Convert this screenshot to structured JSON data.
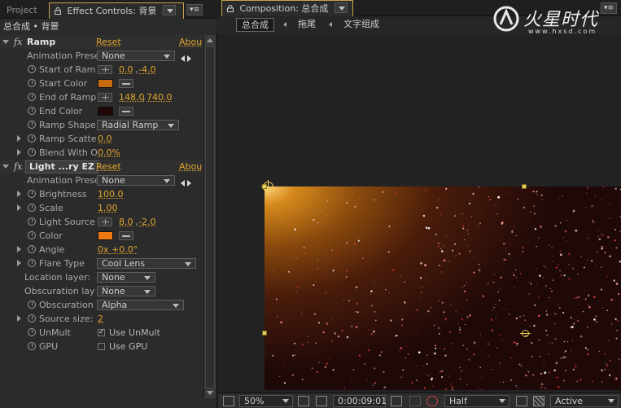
{
  "left_panel": {
    "tabs": {
      "project": "Project",
      "effect_controls": "Effect Controls: 背景"
    },
    "subtitle": "总合成 • 背景",
    "ramp": {
      "name": "Ramp",
      "reset": "Reset",
      "about": "Abou",
      "animation_preset_label": "Animation Prese",
      "animation_preset_value": "None",
      "start_of_ramp_label": "Start of Ram",
      "start_of_ramp_value_x": "0.0",
      "start_of_ramp_value_y": "-4.0",
      "start_color_label": "Start Color",
      "start_color": "#c86a10",
      "end_of_ramp_label": "End of Ramp",
      "end_of_ramp_value_x": "148.0",
      "end_of_ramp_value_y": "740.0",
      "end_color_label": "End Color",
      "end_color": "#200606",
      "ramp_shape_label": "Ramp Shape",
      "ramp_shape_value": "Radial Ramp",
      "ramp_scatter_label": "Ramp Scatte",
      "ramp_scatter_value": "0.0",
      "blend_label": "Blend With O",
      "blend_value": "0.0%"
    },
    "light": {
      "name": "Light ...ry EZ",
      "reset": "Reset",
      "about": "Abou",
      "animation_preset_label": "Animation Prese",
      "animation_preset_value": "None",
      "brightness_label": "Brightness",
      "brightness_value": "100.0",
      "scale_label": "Scale",
      "scale_value": "1.00",
      "light_source_label": "Light Source",
      "light_source_x": "8.0",
      "light_source_y": "-2.0",
      "color_label": "Color",
      "color": "#f07a12",
      "angle_label": "Angle",
      "angle_value": "0x +0.0°",
      "flare_type_label": "Flare Type",
      "flare_type_value": "Cool Lens",
      "location_layer_label": "Location layer:",
      "location_layer_value": "None",
      "obscuration_layer_label": "Obscuration lay",
      "obscuration_layer_value": "None",
      "obscuration_label": "Obscuration",
      "obscuration_value": "Alpha",
      "source_size_label": "Source size:",
      "source_size_value": "2",
      "unmult_label": "UnMult",
      "unmult_check": "Use UnMult",
      "unmult_checked": true,
      "gpu_label": "GPU",
      "gpu_check": "Use GPU",
      "gpu_checked": false
    }
  },
  "right_panel": {
    "tab": "Composition: 总合成",
    "breadcrumbs": [
      "总合成",
      "拖尾",
      "文字组成"
    ],
    "logo": {
      "name": "火星时代",
      "url": "www.hxsd.com"
    },
    "bottom_bar": {
      "zoom": "50%",
      "timecode": "0:00:09:01",
      "resolution": "Half",
      "camera": "Active Camera"
    }
  }
}
